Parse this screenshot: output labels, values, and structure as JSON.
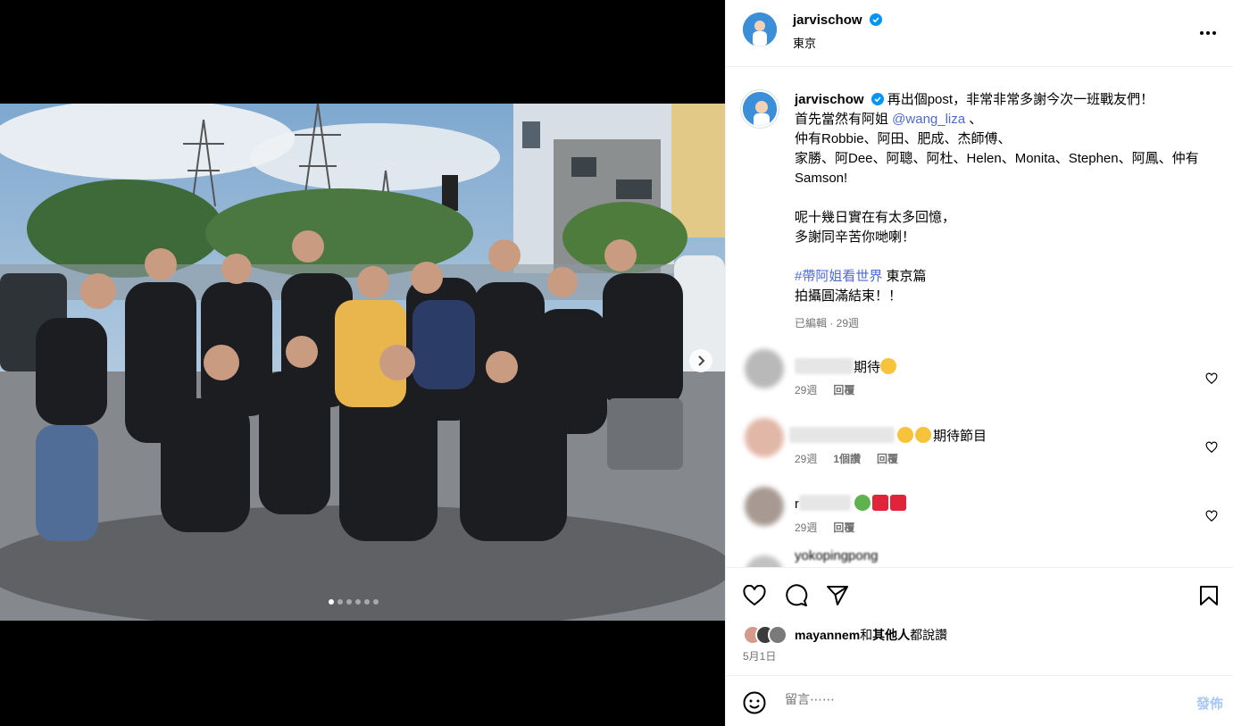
{
  "colors": {
    "accent": "#0095f6",
    "link": "#4c69d6",
    "muted": "#737373"
  },
  "header": {
    "username": "jarvischow",
    "location": "東京"
  },
  "caption": {
    "username": "jarvischow",
    "line1": "再出個post，非常非常多謝今次一班戰友們！",
    "line2_prefix": "首先當然有阿姐 ",
    "mention": "@wang_liza",
    "line2_suffix": " 、",
    "line3": "仲有Robbie、阿田、肥成、杰師傅、",
    "line4": "家勝、阿Dee、阿聰、阿杜、Helen、Monita、Stephen、阿鳳、仲有Samson!",
    "line5": "呢十幾日實在有太多回憶，",
    "line6": "多謝同辛苦你哋喇！",
    "hashtag": "#帶阿姐看世界",
    "hashtag_suffix": " 東京篇",
    "line8": "拍攝圓滿結束！！",
    "edited": "已編輯 · 29週"
  },
  "comments": [
    {
      "name_visible": "",
      "text": "期待",
      "time": "29週",
      "reply": "回覆",
      "replies": ""
    },
    {
      "name_visible": "",
      "text": "期待節目",
      "time": "29週",
      "reply": "回覆",
      "replies": "1個讚"
    },
    {
      "name_visible": "r",
      "text": "",
      "time": "29週",
      "reply": "回覆",
      "replies": ""
    },
    {
      "name_visible": "yokopingpong",
      "text": "",
      "time": "",
      "reply": "",
      "replies": ""
    }
  ],
  "likes": {
    "first_user": "mayannem",
    "connector": "和",
    "others": "其他人",
    "suffix": "都說讚"
  },
  "date": "5月1日",
  "comment_box": {
    "placeholder": "留言⋯⋯",
    "post_label": "發佈"
  },
  "icons": [
    "heart-icon",
    "comment-icon",
    "share-icon",
    "bookmark-icon",
    "emoji-icon",
    "more-icon",
    "verified-icon",
    "next-arrow-icon"
  ]
}
